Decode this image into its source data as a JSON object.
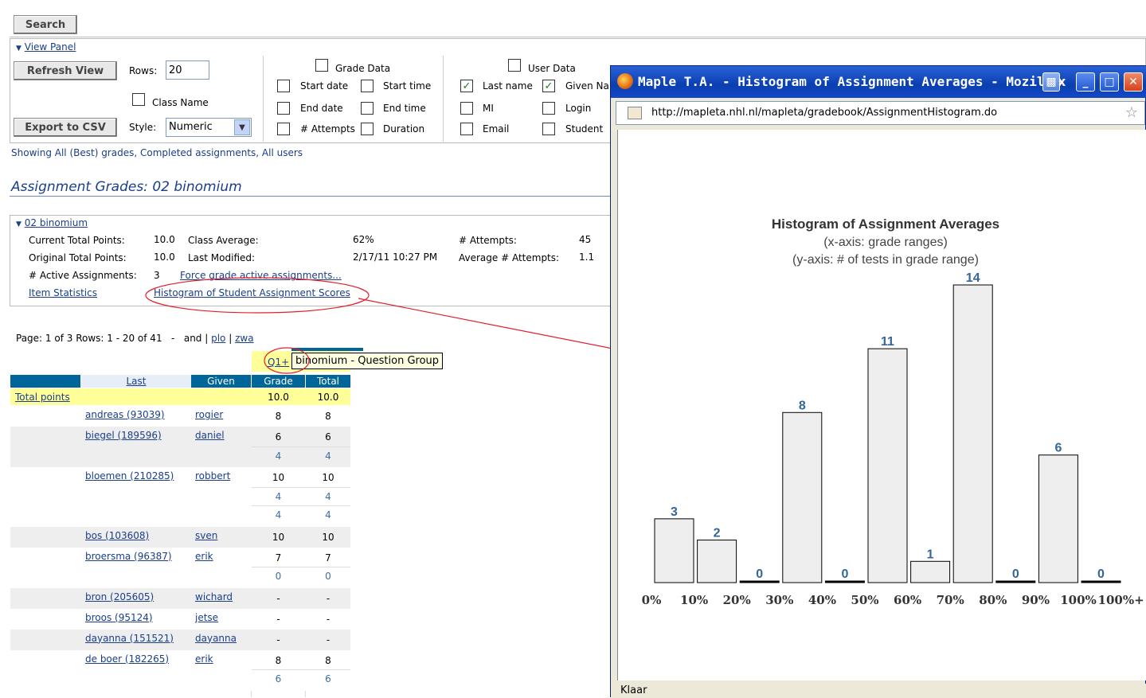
{
  "search_label": "Search",
  "view_panel_label": "View Panel",
  "refresh_label": "Refresh View",
  "rows_label": "Rows:",
  "rows_value": "20",
  "class_name_label": "Class Name",
  "export_label": "Export to CSV",
  "style_label": "Style:",
  "style_value": "Numeric",
  "grade_data_label": "Grade Data",
  "user_data_label": "User Data",
  "grade_fields": [
    "Start date",
    "Start time",
    "End date",
    "End time",
    "# Attempts",
    "Duration"
  ],
  "user_fields": [
    "Last name",
    "Given Na",
    "MI",
    "Login",
    "Email",
    "Student"
  ],
  "showing_text": "Showing All (Best) grades, Completed assignments, All users",
  "assignment_title": "Assignment Grades: 02 binomium",
  "section_title": "02 binomium",
  "stats": {
    "current_total_label": "Current Total Points:",
    "current_total": "10.0",
    "class_avg_label": "Class Average:",
    "class_avg": "62%",
    "attempts_label": "# Attempts:",
    "attempts": "45",
    "original_total_label": "Original Total Points:",
    "original_total": "10.0",
    "last_modified_label": "Last Modified:",
    "last_modified": "2/17/11 10:27 PM",
    "avg_attempts_label": "Average # Attempts:",
    "avg_attempts": "1.1",
    "active_label": "# Active Assignments:",
    "active": "3",
    "force_grade": "Force grade active assignments...",
    "item_stats": "Item Statistics",
    "histogram_link": "Histogram of Student Assignment Scores"
  },
  "pager": {
    "text": "Page: 1 of 3 Rows: 1 - 20 of 41",
    "sep": "-",
    "and_text": "and |",
    "plo": "plo",
    "bar": "|",
    "zwa": "zwa"
  },
  "q1_label": "Q1+",
  "tooltip": "binomium - Question Group",
  "table": {
    "headers": [
      "Last",
      "Given",
      "Grade",
      "Total"
    ],
    "total_points_label": "Total points",
    "total_grade": "10.0",
    "total_total": "10.0",
    "rows": [
      {
        "last": "andreas (93039)",
        "given": "rogier",
        "grades": [
          [
            "8",
            "8"
          ]
        ]
      },
      {
        "last": "biegel (189596)",
        "given": "daniel",
        "grades": [
          [
            "6",
            "6"
          ],
          [
            "4",
            "4"
          ]
        ]
      },
      {
        "last": "bloemen (210285)",
        "given": "robbert",
        "grades": [
          [
            "10",
            "10"
          ],
          [
            "4",
            "4"
          ],
          [
            "4",
            "4"
          ]
        ]
      },
      {
        "last": "bos (103608)",
        "given": "sven",
        "grades": [
          [
            "10",
            "10"
          ]
        ]
      },
      {
        "last": "broersma (96387)",
        "given": "erik",
        "grades": [
          [
            "7",
            "7"
          ],
          [
            "0",
            "0"
          ]
        ]
      },
      {
        "last": "bron (205605)",
        "given": "wichard",
        "grades": [
          [
            "-",
            "-"
          ]
        ]
      },
      {
        "last": "broos (95124)",
        "given": "jetse",
        "grades": [
          [
            "-",
            "-"
          ]
        ]
      },
      {
        "last": "dayanna (151521)",
        "given": "dayanna",
        "grades": [
          [
            "-",
            "-"
          ]
        ]
      },
      {
        "last": "de boer (182265)",
        "given": "erik",
        "grades": [
          [
            "8",
            "8"
          ],
          [
            "6",
            "6"
          ]
        ]
      }
    ]
  },
  "popup": {
    "title": "Maple T.A. - Histogram of Assignment Averages - Mozilla Fir",
    "title_tail": "x",
    "url": "http://mapleta.nhl.nl/mapleta/gradebook/AssignmentHistogram.do",
    "status": "Klaar"
  },
  "chart_data": {
    "type": "bar",
    "title": "Histogram of Assignment Averages",
    "subtitle1": "(x-axis: grade ranges)",
    "subtitle2": "(y-axis: # of tests in grade range)",
    "categories": [
      "0%",
      "10%",
      "20%",
      "30%",
      "40%",
      "50%",
      "60%",
      "70%",
      "80%",
      "90%",
      "100%",
      "100%+"
    ],
    "values": [
      3,
      2,
      0,
      8,
      0,
      11,
      1,
      14,
      0,
      6,
      0
    ],
    "ylim": [
      0,
      14
    ],
    "grid": false,
    "bar_color": "#eeeeee",
    "label_color": "#336699"
  },
  "colors": {
    "table_header": "#006699",
    "highlight": "#ffff99",
    "link": "#1a3e8c",
    "annotation": "#e0202c"
  }
}
